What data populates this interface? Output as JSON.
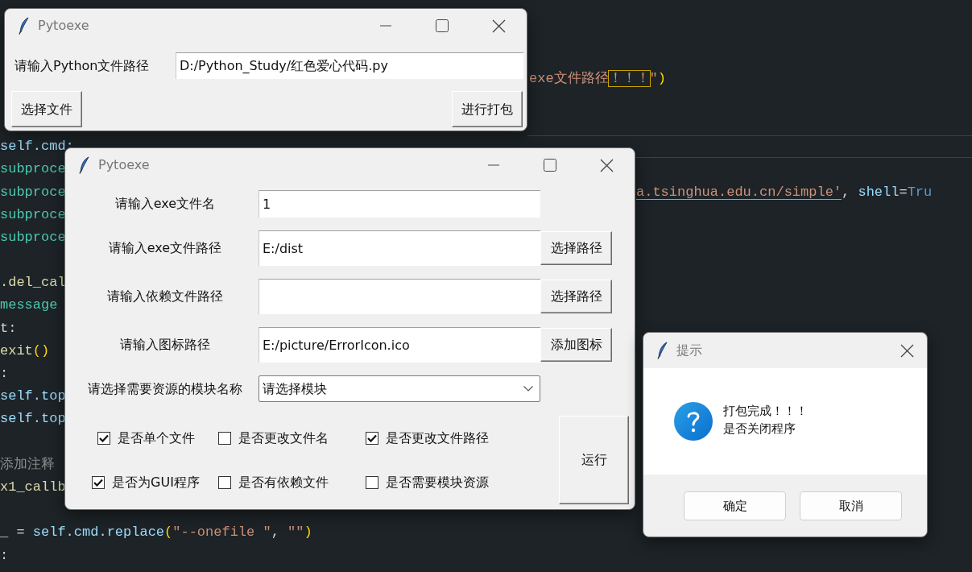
{
  "editor": {
    "lines": [
      {
        "segments": [
          {
            "text": "exe文件路径",
            "kind": "string"
          },
          {
            "text": "！！！",
            "kind": "match"
          },
          {
            "text": "\"",
            "kind": "string"
          },
          {
            "text": ")",
            "kind": "paren"
          }
        ]
      },
      {
        "segments": [
          {
            "text": "self.cmd:",
            "kind": "name"
          }
        ]
      },
      {
        "segments": [
          {
            "text": "subproce",
            "kind": "type"
          }
        ]
      },
      {
        "segments": [
          {
            "text": "subproce",
            "kind": "type"
          }
        ]
      },
      {
        "segments": [
          {
            "text": "a.tsinghua.edu.cn/simple'",
            "kind": "link"
          },
          {
            "text": ", ",
            "kind": "plain"
          },
          {
            "text": "shell",
            "kind": "name"
          },
          {
            "text": "=",
            "kind": "plain"
          },
          {
            "text": "Tru",
            "kind": "keyword"
          }
        ]
      },
      {
        "segments": [
          {
            "text": "subproce",
            "kind": "type"
          }
        ]
      },
      {
        "segments": [
          {
            "text": "subproce",
            "kind": "type"
          }
        ]
      },
      {
        "segments": [
          {
            "text": ".del_cal",
            "kind": "func"
          }
        ]
      },
      {
        "segments": [
          {
            "text": "message",
            "kind": "type"
          }
        ]
      },
      {
        "segments": [
          {
            "text": "t:",
            "kind": "plain"
          }
        ]
      },
      {
        "segments": [
          {
            "text": "exit",
            "kind": "func"
          },
          {
            "text": "()",
            "kind": "paren"
          }
        ]
      },
      {
        "segments": [
          {
            "text": ":",
            "kind": "plain"
          }
        ]
      },
      {
        "segments": [
          {
            "text": "self.top",
            "kind": "name"
          }
        ]
      },
      {
        "segments": [
          {
            "text": "self.top",
            "kind": "name"
          }
        ]
      },
      {
        "segments": [
          {
            "text": "添加注释",
            "kind": "comment"
          }
        ]
      },
      {
        "segments": [
          {
            "text": "x1_callb",
            "kind": "func"
          }
        ]
      },
      {
        "segments": [
          {
            "text": "_ = ",
            "kind": "plain"
          },
          {
            "text": "self.cmd.replace",
            "kind": "name"
          },
          {
            "text": "(",
            "kind": "paren"
          },
          {
            "text": "\"--onefile \"",
            "kind": "string"
          },
          {
            "text": ", ",
            "kind": "plain"
          },
          {
            "text": "\"\"",
            "kind": "string"
          },
          {
            "text": ")",
            "kind": "paren"
          }
        ]
      },
      {
        "segments": [
          {
            "text": ":",
            "kind": "plain"
          }
        ]
      }
    ]
  },
  "packer_window": {
    "title": "Pytoexe",
    "path_label": "请输入Python文件路径",
    "path_value": "D:/Python_Study/红色爱心代码.py",
    "buttons": [
      "选择文件",
      "进行打包"
    ]
  },
  "options_window": {
    "title": "Pytoexe",
    "fields": [
      {
        "kind": "entry",
        "label": "请输入exe文件名",
        "value": "1"
      },
      {
        "kind": "entry",
        "label": "请输入exe文件路径",
        "value": "E:/dist",
        "button": "选择路径"
      },
      {
        "kind": "entry",
        "label": "请输入依赖文件路径",
        "button": "选择路径"
      },
      {
        "kind": "entry",
        "label": "请输入图标路径",
        "value": "E:/picture/ErrorIcon.ico",
        "button": "添加图标"
      },
      {
        "kind": "combobox",
        "label": "请选择需要资源的模块名称",
        "value": "请选择模块"
      }
    ],
    "options": [
      {
        "label": "是否单个文件",
        "checked": true
      },
      {
        "label": "是否更改文件名",
        "checked": false
      },
      {
        "label": "是否更改文件路径",
        "checked": true
      },
      {
        "label": "是否为GUI程序",
        "checked": true
      },
      {
        "label": "是否有依赖文件",
        "checked": false
      },
      {
        "label": "是否需要模块资源",
        "checked": false
      }
    ],
    "run_button": "运行"
  },
  "dialog": {
    "title": "提示",
    "message_lines": [
      "打包完成！！！",
      "是否关闭程序"
    ],
    "buttons": [
      "确定",
      "取消"
    ]
  }
}
